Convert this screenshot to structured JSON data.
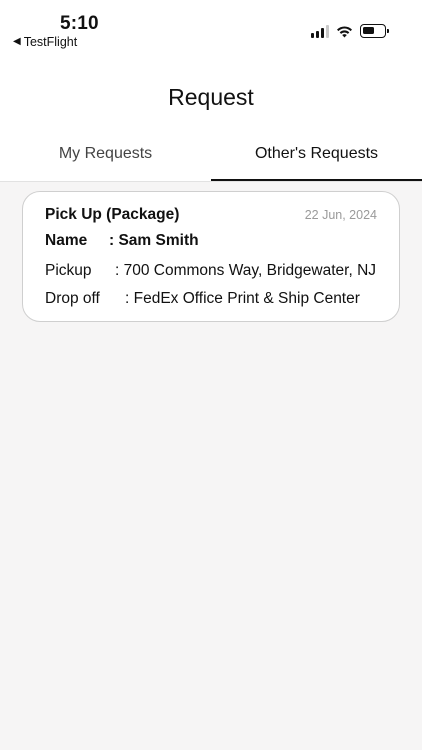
{
  "status_bar": {
    "time": "5:10",
    "back_app": "TestFlight",
    "icons": [
      "signal-icon",
      "wifi-icon",
      "battery-icon"
    ],
    "battery_level": 0.5
  },
  "header": {
    "title": "Request"
  },
  "tabs": [
    {
      "label": "My Requests",
      "active": false
    },
    {
      "label": "Other's Requests",
      "active": true
    }
  ],
  "requests": [
    {
      "type": "Pick Up (Package)",
      "date": "22 Jun, 2024",
      "name_label": "Name",
      "name_value": ": Sam Smith",
      "pickup_label": "Pickup",
      "pickup_value": ": 700 Commons Way, Bridgewater, NJ",
      "dropoff_label": "Drop off",
      "dropoff_value": ": FedEx Office Print & Ship Center"
    }
  ],
  "colors": {
    "background": "#f6f5f5",
    "surface": "#ffffff",
    "text": "#111111",
    "muted": "#9a9a9a",
    "card_border": "#cfcfcf"
  }
}
